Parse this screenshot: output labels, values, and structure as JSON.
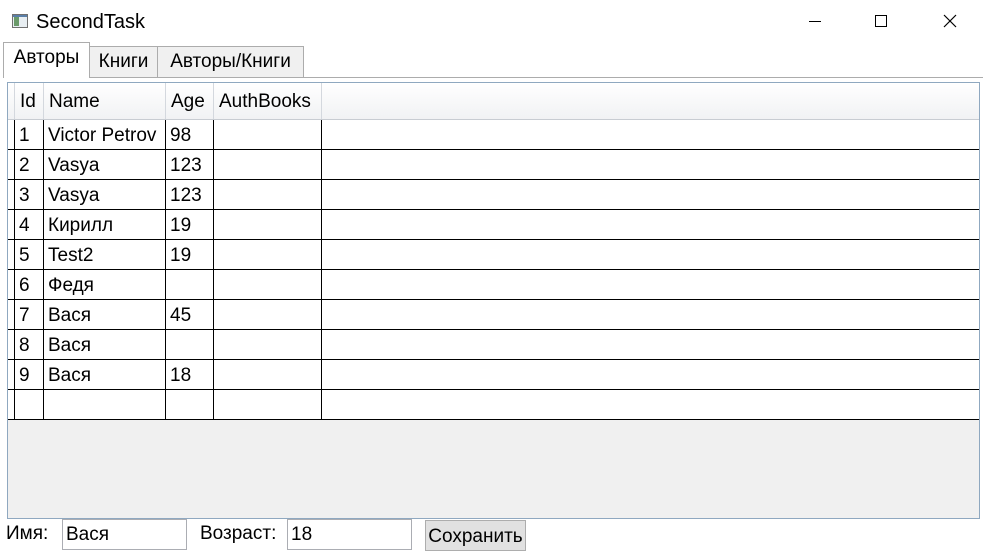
{
  "window": {
    "title": "SecondTask",
    "icon": "app-window-icon",
    "controls": [
      "minimize-icon",
      "maximize-icon",
      "close-icon"
    ]
  },
  "tabs": [
    {
      "label": "Авторы",
      "selected": true
    },
    {
      "label": "Книги",
      "selected": false
    },
    {
      "label": "Авторы/Книги",
      "selected": false
    }
  ],
  "grid": {
    "columns": [
      "Id",
      "Name",
      "Age",
      "AuthBooks"
    ],
    "rows": [
      {
        "id": "1",
        "name": "Victor Petrov",
        "age": "98",
        "books": ""
      },
      {
        "id": "2",
        "name": "Vasya",
        "age": "123",
        "books": ""
      },
      {
        "id": "3",
        "name": "Vasya",
        "age": "123",
        "books": ""
      },
      {
        "id": "4",
        "name": "Кирилл",
        "age": "19",
        "books": ""
      },
      {
        "id": "5",
        "name": "Test2",
        "age": "19",
        "books": ""
      },
      {
        "id": "6",
        "name": "Федя",
        "age": "",
        "books": ""
      },
      {
        "id": "7",
        "name": "Вася",
        "age": "45",
        "books": ""
      },
      {
        "id": "8",
        "name": "Вася",
        "age": "",
        "books": ""
      },
      {
        "id": "9",
        "name": "Вася",
        "age": "18",
        "books": ""
      },
      {
        "id": "",
        "name": "",
        "age": "",
        "books": ""
      }
    ]
  },
  "form": {
    "name_label": "Имя:",
    "name_value": "Вася",
    "age_label": "Возраст:",
    "age_value": "18",
    "save_label": "Сохранить"
  },
  "colors": {
    "grid_border": "#8fa8c0",
    "grid_background": "#f0f0f0",
    "button_face": "#e1e1e1"
  }
}
